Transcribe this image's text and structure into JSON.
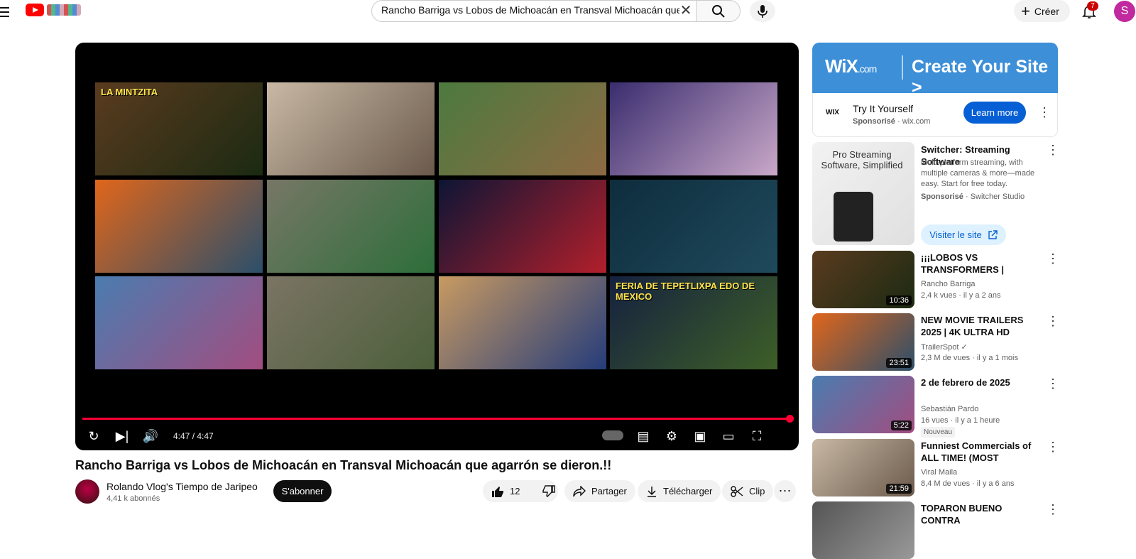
{
  "header": {
    "search_value": "Rancho Barriga vs Lobos de Michoacán en Transval Michoacán que agarrón se dieron.!!",
    "create_label": "Créer",
    "notification_count": "7",
    "avatar_letter": "S"
  },
  "player": {
    "time": "4:47 / 4:47",
    "progress": 1.0,
    "endscreen_tiles": [
      {
        "label": "LA MINTZITA",
        "colors": [
          "#5a3b1f",
          "#1b2a12"
        ]
      },
      {
        "label": "",
        "colors": [
          "#c8b8a4",
          "#6b5a4c"
        ]
      },
      {
        "label": "",
        "colors": [
          "#4c7a3f",
          "#8d6a43"
        ]
      },
      {
        "label": "",
        "colors": [
          "#3a2d6e",
          "#c9a8c8"
        ]
      },
      {
        "label": "",
        "colors": [
          "#e0661b",
          "#2b4f6b"
        ]
      },
      {
        "label": "",
        "colors": [
          "#777766",
          "#2d6e3a"
        ]
      },
      {
        "label": "",
        "colors": [
          "#0d1535",
          "#b21f2b"
        ]
      },
      {
        "label": "",
        "colors": [
          "#0e2d3d",
          "#1f4a5c"
        ]
      },
      {
        "label": "",
        "colors": [
          "#4b7cb0",
          "#a24d80"
        ]
      },
      {
        "label": "",
        "colors": [
          "#7b7464",
          "#4b5f3a"
        ]
      },
      {
        "label": "",
        "colors": [
          "#c89a62",
          "#253c7a"
        ]
      },
      {
        "label": "FERIA DE TEPETLIXPA EDO DE MEXICO",
        "colors": [
          "#15213f",
          "#3d5f27"
        ]
      }
    ]
  },
  "video": {
    "title": "Rancho Barriga vs Lobos de Michoacán en Transval Michoacán que agarrón se dieron.!!",
    "channel": "Rolando Vlog's Tiempo de Jaripeo",
    "subscribers": "4,41 k abonnés",
    "subscribe_label": "S'abonner",
    "likes": "12",
    "share_label": "Partager",
    "download_label": "Télécharger",
    "clip_label": "Clip"
  },
  "ad": {
    "brand": "WiX",
    "brand_suffix": ".com",
    "headline": "Create Your Site >",
    "logo_text": "WIX",
    "title": "Try It Yourself",
    "sponsor_label": "Sponsorisé",
    "domain": "· wix.com",
    "cta": "Learn more"
  },
  "sidebar": {
    "promo": {
      "thumb_text": "Pro Streaming Software, Simplified",
      "title": "Switcher: Streaming Software",
      "description": "Multi-platform streaming, with multiple cameras & more—made easy. Start for free today.",
      "sponsor_label": "Sponsorisé",
      "sponsor_name": "· Switcher Studio",
      "cta": "Visiter le site"
    },
    "videos": [
      {
        "title": "¡¡¡LOBOS VS TRANSFORMERS | MODELO SIGUE EN ACCION!!!...",
        "channel": "Rancho Barriga",
        "meta": "2,4 k vues · il y a 2 ans",
        "duration": "10:36",
        "colors": [
          "#5a3b1f",
          "#1b2a12"
        ]
      },
      {
        "title": "NEW MOVIE TRAILERS 2025 | 4K ULTRA HD",
        "channel": "TrailerSpot ✓",
        "meta": "2,3 M de vues · il y a 1 mois",
        "duration": "23:51",
        "colors": [
          "#e0661b",
          "#2b4f6b"
        ]
      },
      {
        "title": "2 de febrero de 2025",
        "channel": "Sebastián Pardo",
        "meta": "16 vues · il y a 1 heure",
        "duration": "5:22",
        "badge": "Nouveau",
        "colors": [
          "#4b7cb0",
          "#a24d80"
        ]
      },
      {
        "title": "Funniest Commercials of ALL TIME! (MOST HILARIOUS Ads...",
        "channel": "Viral Maila",
        "meta": "8,4 M de vues · il y a 6 ans",
        "duration": "21:59",
        "colors": [
          "#c8b8a4",
          "#6b5a4c"
        ]
      },
      {
        "title": "TOPARON BUENO CONTRA",
        "channel": "",
        "meta": "",
        "duration": "",
        "colors": [
          "#555",
          "#999"
        ]
      }
    ]
  }
}
